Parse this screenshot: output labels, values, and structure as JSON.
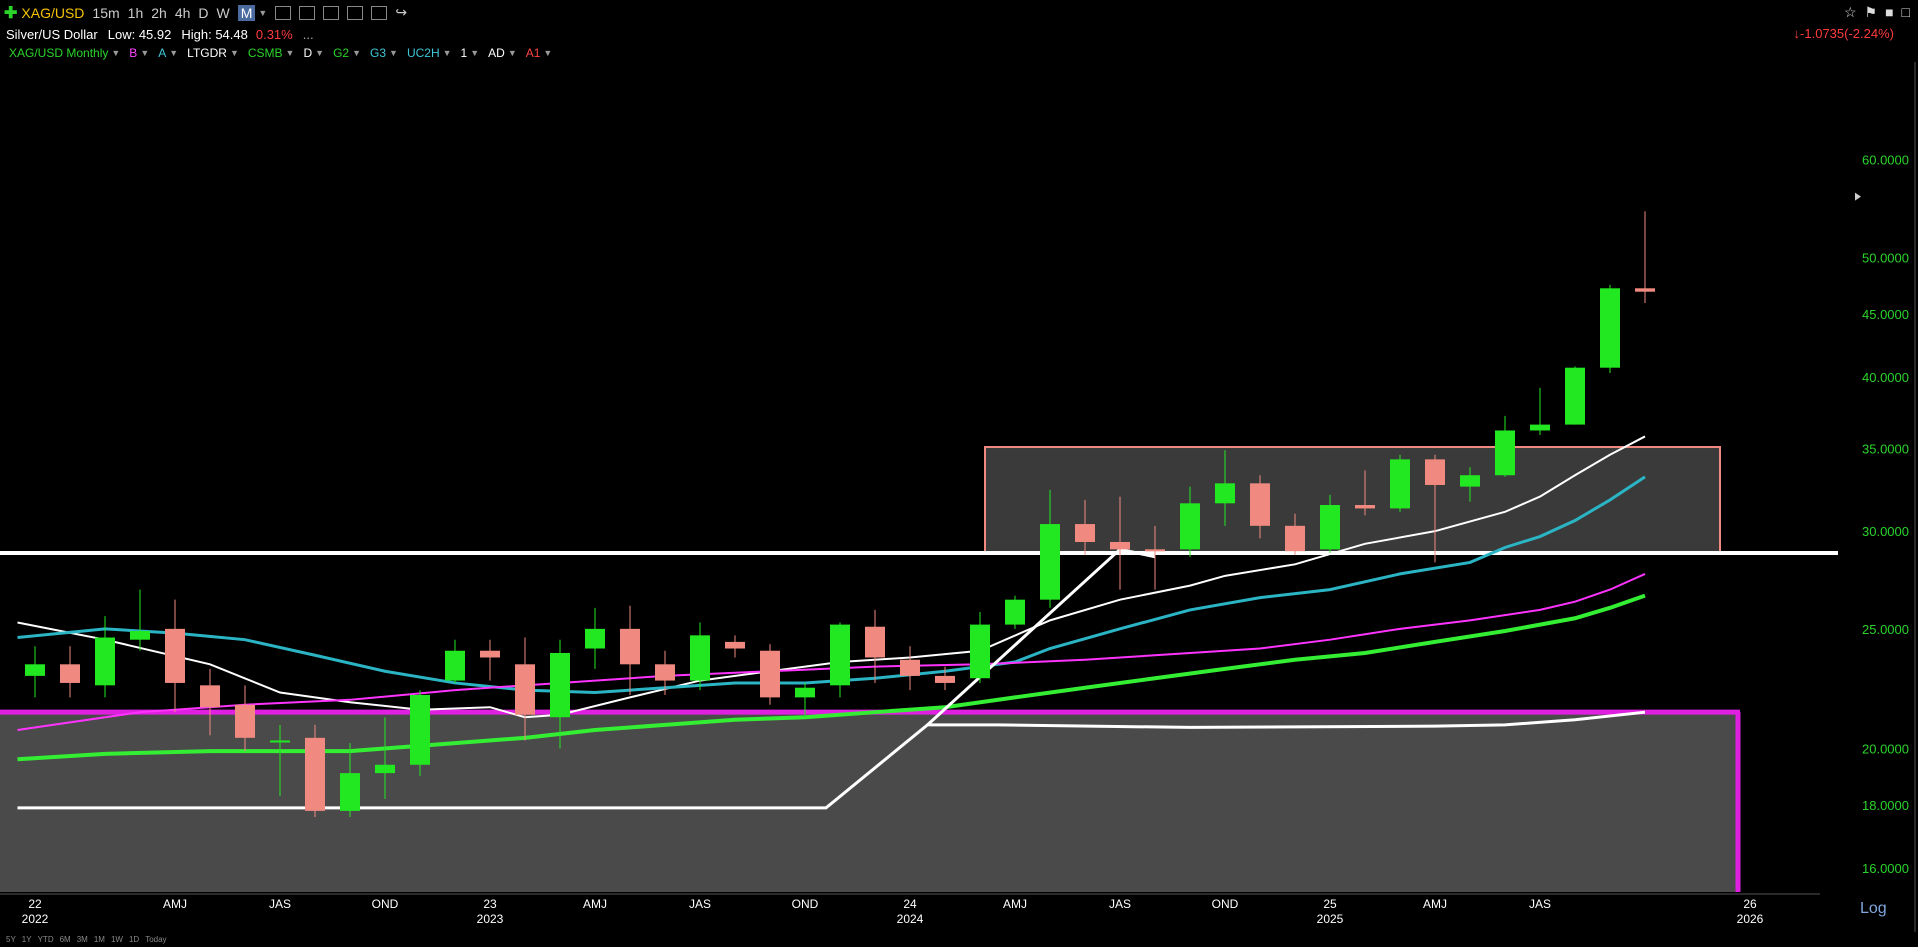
{
  "toolbar": {
    "symbol": "XAG/USD",
    "timeframes": [
      "15m",
      "1h",
      "2h",
      "4h",
      "D",
      "W",
      "M"
    ],
    "active_timeframe": "M"
  },
  "info": {
    "name": "Silver/US Dollar",
    "low_label": "Low: 45.92",
    "high_label": "High: 54.48",
    "change_pct": "0.31%",
    "ellipsis": "...",
    "right_change": "↓-1.0735(-2.24%)"
  },
  "studies": [
    {
      "label": "XAG/USD Monthly",
      "color": "#2bd42b"
    },
    {
      "label": "B",
      "color": "#ff44ff"
    },
    {
      "label": "A",
      "color": "#3fc6d6"
    },
    {
      "label": "LTGDR",
      "color": "#ffffff"
    },
    {
      "label": "CSMB",
      "color": "#2bd42b"
    },
    {
      "label": "D",
      "color": "#ffffff"
    },
    {
      "label": "G2",
      "color": "#2bd42b"
    },
    {
      "label": "G3",
      "color": "#3fc6d6"
    },
    {
      "label": "UC2H",
      "color": "#3fc6d6"
    },
    {
      "label": "1",
      "color": "#ffffff"
    },
    {
      "label": "AD",
      "color": "#ffffff"
    },
    {
      "label": "A1",
      "color": "#ff4444"
    }
  ],
  "bottom_ranges": [
    "5Y",
    "1Y",
    "YTD",
    "6M",
    "3M",
    "1M",
    "1W",
    "1D",
    "Today"
  ],
  "log_label": "Log",
  "colors": {
    "up": "#22e822",
    "down": "#f08a80",
    "axis_text": "#2bd42b"
  },
  "chart_data": {
    "type": "candlestick",
    "scale": "log",
    "ylim": [
      15.3,
      72
    ],
    "y_ticks": [
      {
        "v": 60,
        "label": "60.0000"
      },
      {
        "v": 50,
        "label": "50.0000"
      },
      {
        "v": 45,
        "label": "45.0000"
      },
      {
        "v": 40,
        "label": "40.0000"
      },
      {
        "v": 35,
        "label": "35.0000"
      },
      {
        "v": 30,
        "label": "30.0000"
      },
      {
        "v": 25,
        "label": "25.0000"
      },
      {
        "v": 20,
        "label": "20.0000"
      },
      {
        "v": 18,
        "label": "18.0000"
      },
      {
        "v": 16,
        "label": "16.0000"
      }
    ],
    "x_ticks": [
      {
        "i": 0,
        "q": "22",
        "y": "2022"
      },
      {
        "i": 4,
        "q": "AMJ",
        "y": ""
      },
      {
        "i": 7,
        "q": "JAS",
        "y": ""
      },
      {
        "i": 10,
        "q": "OND",
        "y": ""
      },
      {
        "i": 13,
        "q": "23",
        "y": "2023"
      },
      {
        "i": 16,
        "q": "AMJ",
        "y": ""
      },
      {
        "i": 19,
        "q": "JAS",
        "y": ""
      },
      {
        "i": 22,
        "q": "OND",
        "y": ""
      },
      {
        "i": 25,
        "q": "24",
        "y": "2024"
      },
      {
        "i": 28,
        "q": "AMJ",
        "y": ""
      },
      {
        "i": 31,
        "q": "JAS",
        "y": ""
      },
      {
        "i": 34,
        "q": "OND",
        "y": ""
      },
      {
        "i": 37,
        "q": "25",
        "y": "2025"
      },
      {
        "i": 40,
        "q": "AMJ",
        "y": ""
      },
      {
        "i": 43,
        "q": "JAS",
        "y": ""
      },
      {
        "i": 49,
        "q": "26",
        "y": "2026"
      }
    ],
    "candles": [
      {
        "i": 0,
        "o": 22.9,
        "h": 24.2,
        "l": 22.0,
        "c": 23.4
      },
      {
        "i": 1,
        "o": 23.4,
        "h": 24.2,
        "l": 22.0,
        "c": 22.6
      },
      {
        "i": 2,
        "o": 22.5,
        "h": 25.6,
        "l": 22.0,
        "c": 24.6
      },
      {
        "i": 3,
        "o": 24.5,
        "h": 26.9,
        "l": 24.0,
        "c": 24.9
      },
      {
        "i": 4,
        "o": 25.0,
        "h": 26.4,
        "l": 21.4,
        "c": 22.6
      },
      {
        "i": 5,
        "o": 22.5,
        "h": 23.2,
        "l": 20.5,
        "c": 21.6
      },
      {
        "i": 6,
        "o": 21.7,
        "h": 22.5,
        "l": 19.9,
        "c": 20.4
      },
      {
        "i": 7,
        "o": 20.3,
        "h": 20.9,
        "l": 18.3,
        "c": 20.3
      },
      {
        "i": 8,
        "o": 20.4,
        "h": 20.9,
        "l": 17.6,
        "c": 17.8
      },
      {
        "i": 9,
        "o": 17.8,
        "h": 20.2,
        "l": 17.6,
        "c": 19.1
      },
      {
        "i": 10,
        "o": 19.1,
        "h": 21.2,
        "l": 18.2,
        "c": 19.4
      },
      {
        "i": 11,
        "o": 19.4,
        "h": 22.3,
        "l": 19.0,
        "c": 22.1
      },
      {
        "i": 12,
        "o": 22.7,
        "h": 24.5,
        "l": 22.6,
        "c": 24.0
      },
      {
        "i": 13,
        "o": 24.0,
        "h": 24.5,
        "l": 22.7,
        "c": 23.7
      },
      {
        "i": 14,
        "o": 23.4,
        "h": 24.6,
        "l": 20.3,
        "c": 21.3
      },
      {
        "i": 15,
        "o": 21.2,
        "h": 24.5,
        "l": 20.0,
        "c": 23.9
      },
      {
        "i": 16,
        "o": 24.1,
        "h": 26.0,
        "l": 23.2,
        "c": 25.0
      },
      {
        "i": 17,
        "o": 25.0,
        "h": 26.1,
        "l": 22.1,
        "c": 23.4
      },
      {
        "i": 18,
        "o": 23.4,
        "h": 24.0,
        "l": 22.1,
        "c": 22.7
      },
      {
        "i": 19,
        "o": 22.7,
        "h": 25.3,
        "l": 22.3,
        "c": 24.7
      },
      {
        "i": 20,
        "o": 24.4,
        "h": 24.7,
        "l": 23.7,
        "c": 24.1
      },
      {
        "i": 21,
        "o": 24.0,
        "h": 24.3,
        "l": 21.7,
        "c": 22.0
      },
      {
        "i": 22,
        "o": 22.0,
        "h": 22.6,
        "l": 21.2,
        "c": 22.4
      },
      {
        "i": 23,
        "o": 22.5,
        "h": 25.3,
        "l": 22.0,
        "c": 25.2
      },
      {
        "i": 24,
        "o": 25.1,
        "h": 25.9,
        "l": 22.6,
        "c": 23.7
      },
      {
        "i": 25,
        "o": 23.6,
        "h": 24.2,
        "l": 22.3,
        "c": 22.9
      },
      {
        "i": 26,
        "o": 22.9,
        "h": 23.3,
        "l": 22.3,
        "c": 22.6
      },
      {
        "i": 27,
        "o": 22.8,
        "h": 25.8,
        "l": 22.6,
        "c": 25.2
      },
      {
        "i": 28,
        "o": 25.2,
        "h": 26.6,
        "l": 25.0,
        "c": 26.4
      },
      {
        "i": 29,
        "o": 26.4,
        "h": 32.4,
        "l": 26.0,
        "c": 30.4
      },
      {
        "i": 30,
        "o": 30.4,
        "h": 31.8,
        "l": 28.7,
        "c": 29.4
      },
      {
        "i": 31,
        "o": 29.4,
        "h": 32.0,
        "l": 26.9,
        "c": 29.0
      },
      {
        "i": 32,
        "o": 29.0,
        "h": 30.3,
        "l": 26.9,
        "c": 28.9
      },
      {
        "i": 33,
        "o": 29.0,
        "h": 32.6,
        "l": 28.6,
        "c": 31.6
      },
      {
        "i": 34,
        "o": 31.6,
        "h": 34.9,
        "l": 30.3,
        "c": 32.8
      },
      {
        "i": 35,
        "o": 32.8,
        "h": 33.3,
        "l": 29.6,
        "c": 30.3
      },
      {
        "i": 36,
        "o": 30.3,
        "h": 31.0,
        "l": 28.7,
        "c": 28.9
      },
      {
        "i": 37,
        "o": 29.0,
        "h": 32.1,
        "l": 28.8,
        "c": 31.5
      },
      {
        "i": 38,
        "o": 31.5,
        "h": 33.6,
        "l": 30.9,
        "c": 31.3
      },
      {
        "i": 39,
        "o": 31.3,
        "h": 34.6,
        "l": 31.1,
        "c": 34.3
      },
      {
        "i": 40,
        "o": 34.3,
        "h": 34.6,
        "l": 28.3,
        "c": 32.7
      },
      {
        "i": 41,
        "o": 32.6,
        "h": 33.8,
        "l": 31.7,
        "c": 33.3
      },
      {
        "i": 42,
        "o": 33.3,
        "h": 37.2,
        "l": 33.2,
        "c": 36.2
      },
      {
        "i": 43,
        "o": 36.2,
        "h": 39.2,
        "l": 35.9,
        "c": 36.6
      },
      {
        "i": 44,
        "o": 36.6,
        "h": 40.8,
        "l": 36.6,
        "c": 40.7
      },
      {
        "i": 45,
        "o": 40.7,
        "h": 47.5,
        "l": 40.3,
        "c": 47.2
      },
      {
        "i": 46,
        "o": 47.2,
        "h": 54.48,
        "l": 45.92,
        "c": 46.9
      }
    ],
    "series": [
      {
        "style": "white-thin",
        "points": [
          [
            -0.5,
            25.3
          ],
          [
            2,
            24.5
          ],
          [
            5,
            23.4
          ],
          [
            7,
            22.2
          ],
          [
            9,
            21.8
          ],
          [
            11,
            21.5
          ],
          [
            13,
            21.6
          ],
          [
            14,
            21.2
          ],
          [
            15,
            21.3
          ],
          [
            17,
            22.0
          ],
          [
            19,
            22.7
          ],
          [
            21,
            23.1
          ],
          [
            23,
            23.5
          ],
          [
            25,
            23.7
          ],
          [
            27,
            24.0
          ],
          [
            29,
            25.4
          ],
          [
            31,
            26.4
          ],
          [
            33,
            27.1
          ],
          [
            34,
            27.6
          ],
          [
            36,
            28.2
          ],
          [
            38,
            29.3
          ],
          [
            40,
            30.0
          ],
          [
            42,
            31.1
          ],
          [
            43,
            32.0
          ],
          [
            44,
            33.3
          ],
          [
            45,
            34.6
          ],
          [
            46,
            35.8
          ]
        ]
      },
      {
        "style": "cyan",
        "points": [
          [
            -0.5,
            24.6
          ],
          [
            2,
            25.0
          ],
          [
            4,
            24.8
          ],
          [
            6,
            24.5
          ],
          [
            8,
            23.8
          ],
          [
            10,
            23.1
          ],
          [
            12,
            22.6
          ],
          [
            14,
            22.3
          ],
          [
            16,
            22.2
          ],
          [
            18,
            22.4
          ],
          [
            20,
            22.6
          ],
          [
            22,
            22.6
          ],
          [
            24,
            22.8
          ],
          [
            26,
            23.1
          ],
          [
            28,
            23.5
          ],
          [
            29,
            24.1
          ],
          [
            31,
            25.0
          ],
          [
            33,
            25.9
          ],
          [
            35,
            26.5
          ],
          [
            37,
            26.9
          ],
          [
            39,
            27.7
          ],
          [
            41,
            28.3
          ],
          [
            42,
            29.1
          ],
          [
            43,
            29.7
          ],
          [
            44,
            30.6
          ],
          [
            45,
            31.8
          ],
          [
            46,
            33.2
          ]
        ]
      },
      {
        "style": "magenta",
        "points": [
          [
            -0.5,
            20.7
          ],
          [
            3,
            21.4
          ],
          [
            6,
            21.7
          ],
          [
            9,
            21.9
          ],
          [
            12,
            22.3
          ],
          [
            15,
            22.6
          ],
          [
            18,
            22.9
          ],
          [
            21,
            23.1
          ],
          [
            24,
            23.3
          ],
          [
            27,
            23.4
          ],
          [
            30,
            23.6
          ],
          [
            33,
            23.9
          ],
          [
            35,
            24.1
          ],
          [
            37,
            24.5
          ],
          [
            39,
            25.0
          ],
          [
            41,
            25.4
          ],
          [
            43,
            25.9
          ],
          [
            44,
            26.3
          ],
          [
            45,
            26.9
          ],
          [
            46,
            27.7
          ]
        ]
      },
      {
        "style": "green-thick",
        "points": [
          [
            -0.5,
            19.6
          ],
          [
            2,
            19.8
          ],
          [
            5,
            19.9
          ],
          [
            9,
            19.9
          ],
          [
            12,
            20.2
          ],
          [
            14,
            20.4
          ],
          [
            16,
            20.7
          ],
          [
            18,
            20.9
          ],
          [
            20,
            21.1
          ],
          [
            22,
            21.2
          ],
          [
            24,
            21.4
          ],
          [
            26,
            21.6
          ],
          [
            28,
            22.0
          ],
          [
            30,
            22.4
          ],
          [
            32,
            22.8
          ],
          [
            34,
            23.2
          ],
          [
            36,
            23.6
          ],
          [
            38,
            23.9
          ],
          [
            40,
            24.4
          ],
          [
            42,
            24.9
          ],
          [
            44,
            25.5
          ],
          [
            45,
            26.0
          ],
          [
            46,
            26.6
          ]
        ]
      },
      {
        "style": "white-thick",
        "points": [
          [
            -0.5,
            17.9
          ],
          [
            22.6,
            17.9
          ],
          [
            25.5,
            20.9
          ],
          [
            27.5,
            20.9
          ],
          [
            33,
            20.8
          ],
          [
            40,
            20.85
          ],
          [
            42,
            20.9
          ],
          [
            44,
            21.1
          ],
          [
            46,
            21.4
          ]
        ]
      },
      {
        "style": "white-thick",
        "points": [
          [
            25.5,
            20.9
          ],
          [
            31,
            29.0
          ],
          [
            32,
            28.6
          ]
        ]
      }
    ],
    "zones": [
      {
        "style": "grey-magenta",
        "x0": -0.5,
        "x1": 49.5,
        "y_top": 21.4,
        "y_bottom": 15.3
      },
      {
        "style": "grey-salmon",
        "x0": 28.5,
        "x1": 49.5,
        "y_top": 35.1,
        "y_bottom": 28.8
      }
    ],
    "hlines": [
      {
        "y": 28.8
      }
    ],
    "last_price_marker": 56.0
  }
}
